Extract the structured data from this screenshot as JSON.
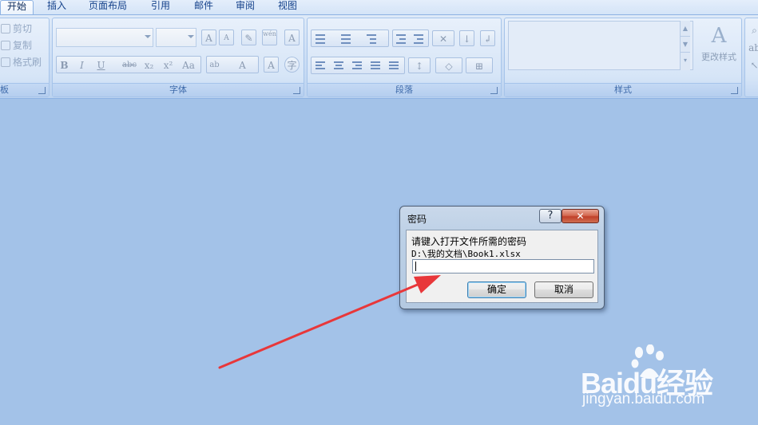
{
  "tabs": [
    {
      "label": "开始",
      "active": true
    },
    {
      "label": "插入"
    },
    {
      "label": "页面布局"
    },
    {
      "label": "引用"
    },
    {
      "label": "邮件"
    },
    {
      "label": "审阅"
    },
    {
      "label": "视图"
    }
  ],
  "ribbon": {
    "clipboard": {
      "title": "板",
      "items": [
        {
          "label": "剪切",
          "icon": "scissors-icon"
        },
        {
          "label": "复制",
          "icon": "copy-icon"
        },
        {
          "label": "格式刷",
          "icon": "format-painter-icon"
        }
      ]
    },
    "font": {
      "title": "字体",
      "bold": "B",
      "italic": "I",
      "underline": "U",
      "strike": "abc",
      "subscript": "x₂",
      "superscript": "x²",
      "case": "Aa",
      "highlight": "ab",
      "font_color": "A",
      "char_shading": "A",
      "enclose": "字",
      "grow": "A",
      "shrink": "A",
      "phonetic": "wén"
    },
    "paragraph": {
      "title": "段落"
    },
    "styles": {
      "title": "样式",
      "change_styles": "更改样式"
    },
    "editing_partial": {
      "find_icon": "find-icon"
    }
  },
  "dialog": {
    "title": "密码",
    "help": "?",
    "close": "✕",
    "prompt": "请键入打开文件所需的密码",
    "path": "D:\\我的文档\\Book1.xlsx",
    "password_value": "",
    "ok": "确定",
    "cancel": "取消"
  },
  "annotation": {
    "color": "#e8373a"
  },
  "watermark": {
    "brand": "Baidu经验",
    "url": "jingyan.baidu.com"
  },
  "colors": {
    "workspace": "#a3c2e8",
    "ribbon_text": "#15428b"
  }
}
